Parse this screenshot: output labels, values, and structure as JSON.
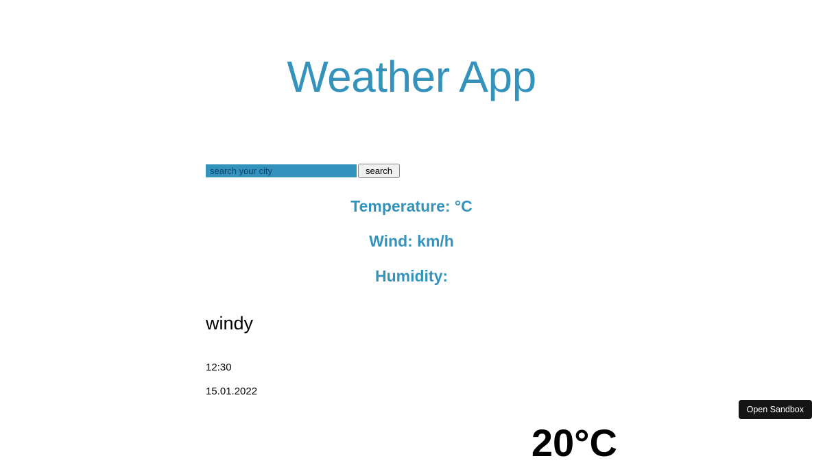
{
  "title": "Weather App",
  "search": {
    "placeholder": "search your city",
    "button_label": "search"
  },
  "metrics": {
    "temperature_label": "Temperature: °C",
    "wind_label": "Wind: km/h",
    "humidity_label": "Humidity:"
  },
  "weather": {
    "condition": "windy",
    "time": "12:30",
    "date": "15.01.2022",
    "temp_display": "20°C"
  },
  "sandbox": {
    "open_label": "Open Sandbox"
  }
}
